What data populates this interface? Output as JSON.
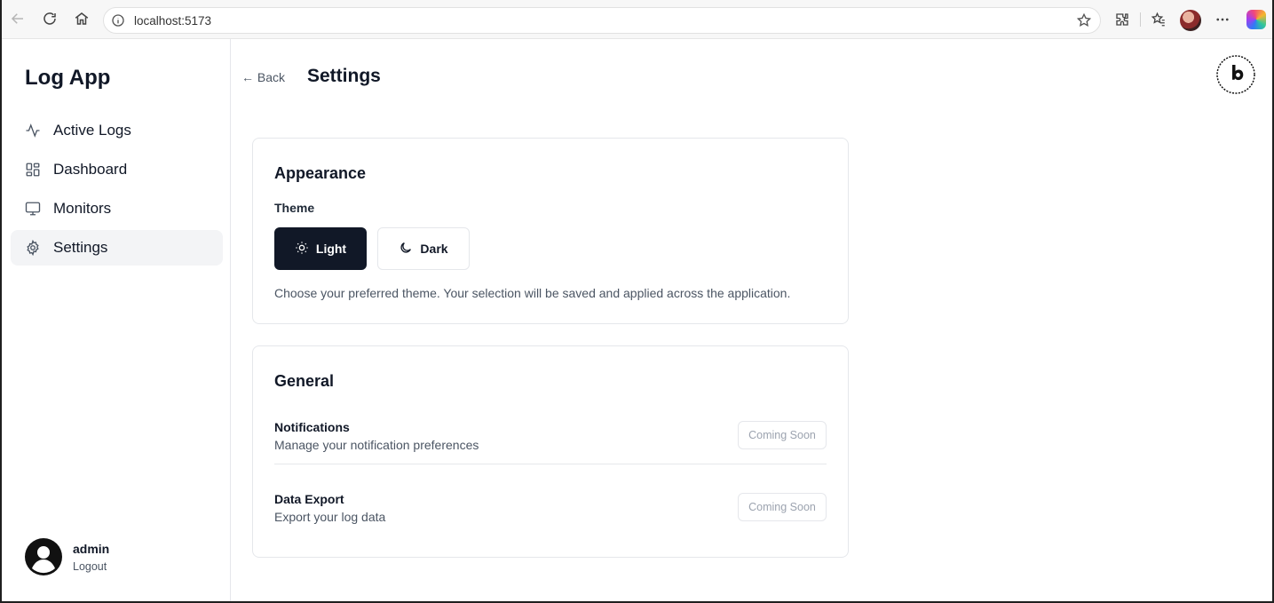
{
  "browser": {
    "url": "localhost:5173"
  },
  "sidebar": {
    "app_title": "Log App",
    "items": [
      {
        "label": "Active Logs",
        "icon": "activity-icon"
      },
      {
        "label": "Dashboard",
        "icon": "dashboard-grid-icon"
      },
      {
        "label": "Monitors",
        "icon": "monitor-icon"
      },
      {
        "label": "Settings",
        "icon": "gear-icon",
        "active": true
      }
    ],
    "user": {
      "name": "admin",
      "logout_label": "Logout"
    }
  },
  "header": {
    "back_label": "← Back",
    "title": "Settings"
  },
  "appearance": {
    "title": "Appearance",
    "theme_label": "Theme",
    "options": [
      {
        "label": "Light",
        "icon": "sun-icon",
        "selected": true
      },
      {
        "label": "Dark",
        "icon": "moon-icon",
        "selected": false
      }
    ],
    "help_text": "Choose your preferred theme. Your selection will be saved and applied across the application."
  },
  "general": {
    "title": "General",
    "rows": [
      {
        "name": "Notifications",
        "description": "Manage your notification preferences",
        "button_label": "Coming Soon"
      },
      {
        "name": "Data Export",
        "description": "Export your log data",
        "button_label": "Coming Soon"
      }
    ]
  },
  "colors": {
    "primary": "#111827",
    "active_bg": "#f3f4f6",
    "border": "#e5e7eb",
    "muted_text": "#4b5563"
  }
}
